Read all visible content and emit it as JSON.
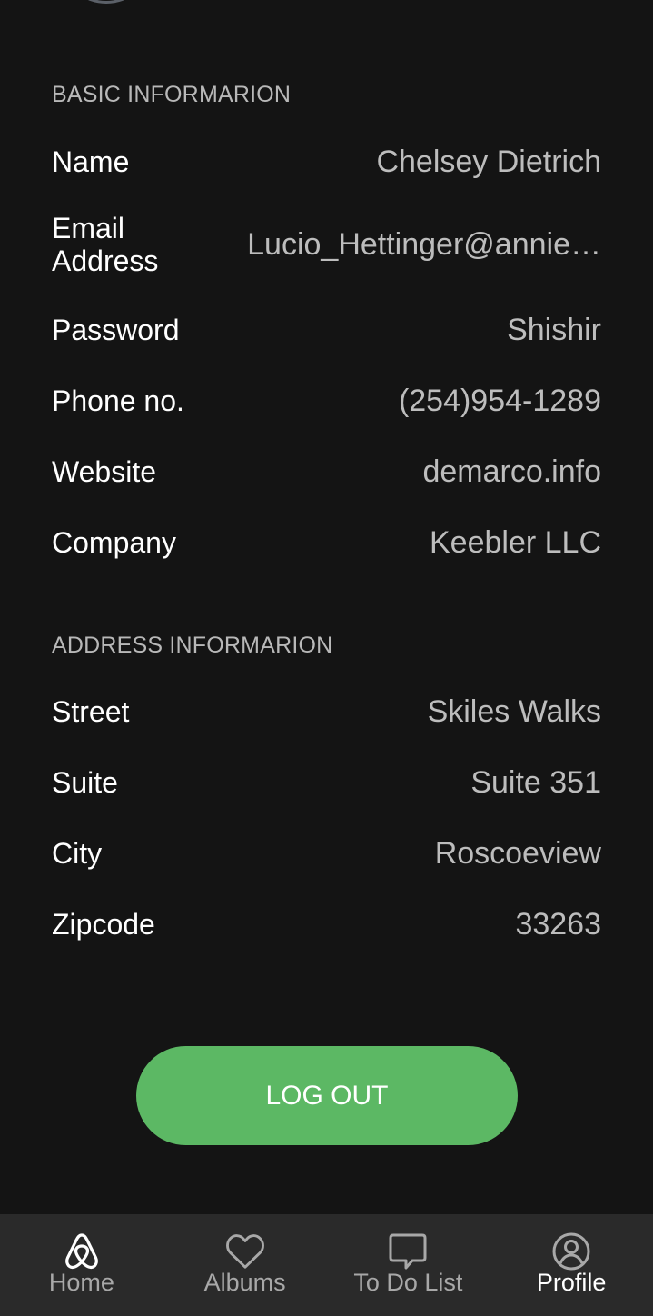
{
  "basic": {
    "header": "BASIC INFORMARION",
    "rows": [
      {
        "label": "Name",
        "value": "Chelsey Dietrich"
      },
      {
        "label": "Email Address",
        "value": "Lucio_Hettinger@annie…"
      },
      {
        "label": "Password",
        "value": "Shishir"
      },
      {
        "label": "Phone no.",
        "value": "(254)954-1289"
      },
      {
        "label": "Website",
        "value": "demarco.info"
      },
      {
        "label": "Company",
        "value": "Keebler LLC"
      }
    ]
  },
  "address": {
    "header": "ADDRESS INFORMARION",
    "rows": [
      {
        "label": "Street",
        "value": "Skiles Walks"
      },
      {
        "label": "Suite",
        "value": "Suite 351"
      },
      {
        "label": "City",
        "value": "Roscoeview"
      },
      {
        "label": "Zipcode",
        "value": "33263"
      }
    ]
  },
  "logout_label": "LOG OUT",
  "colors": {
    "background": "#141414",
    "accent": "#5cb864",
    "nav_background": "#2a2a2a"
  },
  "nav": {
    "items": [
      {
        "label": "Home",
        "icon": "airbnb-icon"
      },
      {
        "label": "Albums",
        "icon": "heart-icon"
      },
      {
        "label": "To Do List",
        "icon": "chat-bubble-icon"
      },
      {
        "label": "Profile",
        "icon": "user-circle-icon",
        "active": true
      }
    ]
  }
}
